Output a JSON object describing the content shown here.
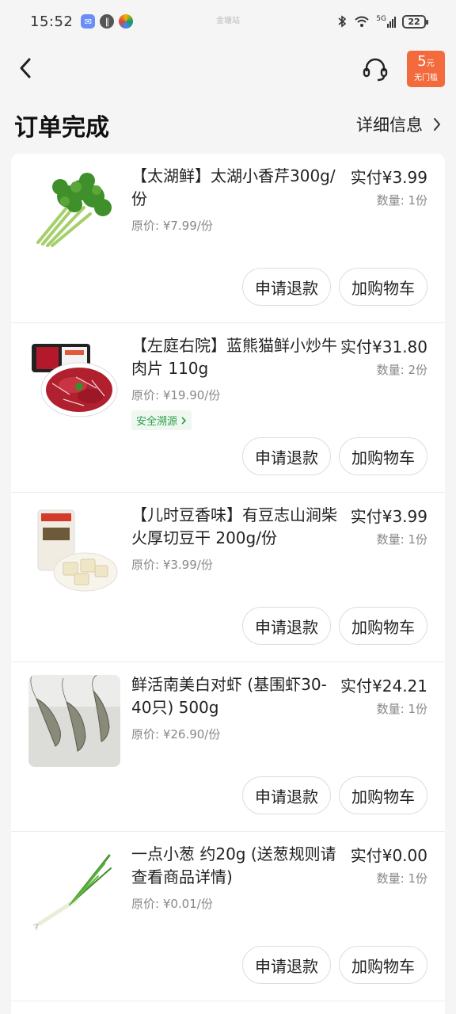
{
  "status_bar": {
    "time": "15:52",
    "center_text": "金塘站",
    "battery": "22",
    "signal": "5G"
  },
  "nav": {
    "back_icon": "chevron-left-icon",
    "service_icon": "headset-icon",
    "coupon_amount": "5",
    "coupon_unit": "元",
    "coupon_label": "无门槛"
  },
  "header": {
    "title": "订单完成",
    "detail_link": "详细信息"
  },
  "items": [
    {
      "name": "【太湖鲜】太湖小香芹300g/份",
      "original_price": "原价: ¥7.99/份",
      "paid": "实付¥3.99",
      "quantity": "数量: 1份",
      "refund_label": "申请退款",
      "cart_label": "加购物车"
    },
    {
      "name": "【左庭右院】蓝熊猫鲜小炒牛肉片 110g",
      "original_price": "原价: ¥19.90/份",
      "trace": "安全溯源",
      "paid": "实付¥31.80",
      "quantity": "数量: 2份",
      "refund_label": "申请退款",
      "cart_label": "加购物车"
    },
    {
      "name": "【儿时豆香味】有豆志山涧柴火厚切豆干 200g/份",
      "original_price": "原价: ¥3.99/份",
      "paid": "实付¥3.99",
      "quantity": "数量: 1份",
      "refund_label": "申请退款",
      "cart_label": "加购物车"
    },
    {
      "name": "鲜活南美白对虾 (基围虾30-40只) 500g",
      "original_price": "原价: ¥26.90/份",
      "paid": "实付¥24.21",
      "quantity": "数量: 1份",
      "refund_label": "申请退款",
      "cart_label": "加购物车"
    },
    {
      "name": "一点小葱 约20g (送葱规则请查看商品详情)",
      "original_price": "原价: ¥0.01/份",
      "paid": "实付¥0.00",
      "quantity": "数量: 1份",
      "refund_label": "申请退款",
      "cart_label": "加购物车"
    }
  ]
}
